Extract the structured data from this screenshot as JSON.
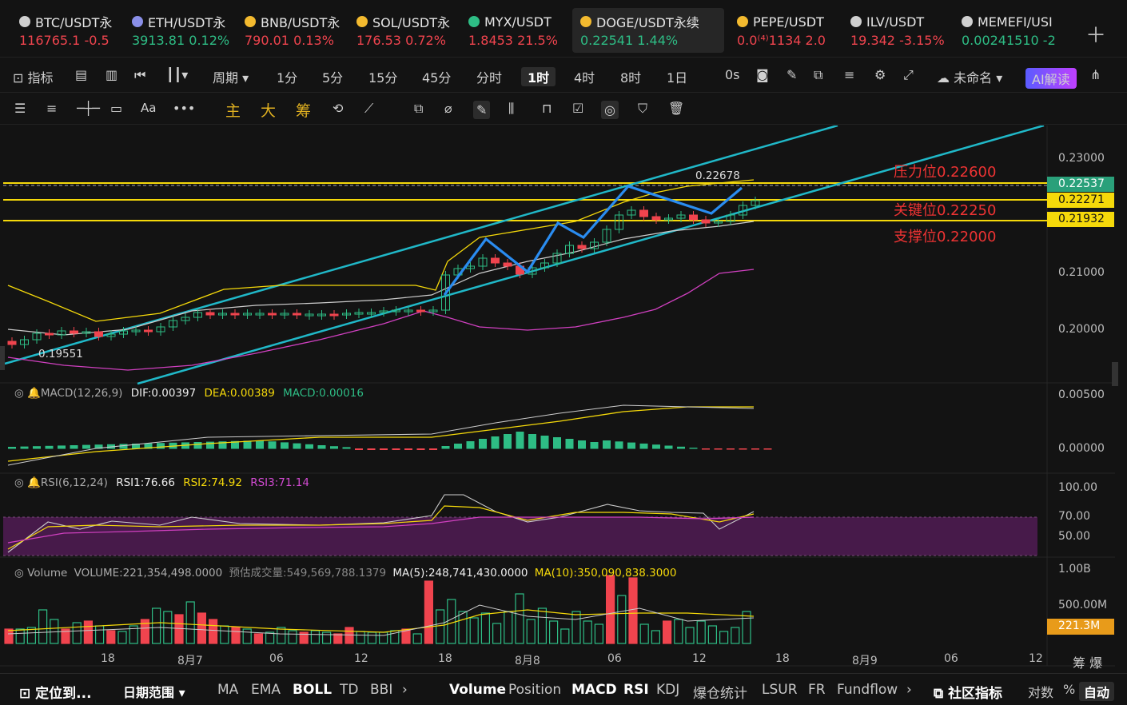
{
  "tickers": [
    {
      "symbol": "BTC/USDT永",
      "price": "116765.1",
      "change": "-0.5",
      "dir": "down",
      "color": "#d0d0d0"
    },
    {
      "symbol": "ETH/USDT永",
      "price": "3913.81",
      "change": "0.12%",
      "dir": "up",
      "color": "#8a8fe8"
    },
    {
      "symbol": "BNB/USDT永",
      "price": "790.01",
      "change": "0.13%",
      "dir": "down",
      "color": "#f3ba2f"
    },
    {
      "symbol": "SOL/USDT永",
      "price": "176.53",
      "change": "0.72%",
      "dir": "down",
      "color": "#f3ba2f"
    },
    {
      "symbol": "MYX/USDT",
      "price": "1.8453",
      "change": "21.5%",
      "dir": "down",
      "color": "#2ebd85"
    },
    {
      "symbol": "DOGE/USDT永续",
      "price": "0.22541",
      "change": "1.44%",
      "dir": "up",
      "color": "#f3ba2f"
    },
    {
      "symbol": "PEPE/USDT",
      "price": "0.0⁽⁴⁾1134",
      "change": "2.0",
      "dir": "down",
      "color": "#f3ba2f"
    },
    {
      "symbol": "ILV/USDT",
      "price": "19.342",
      "change": "-3.15%",
      "dir": "down",
      "color": "#d0d0d0"
    },
    {
      "symbol": "MEMEFI/USI",
      "price": "0.00241510",
      "change": "-2",
      "dir": "up",
      "color": "#d0d0d0"
    }
  ],
  "toolbar": {
    "indicator": "指标",
    "period": "周期",
    "intervals": [
      "1分",
      "5分",
      "15分",
      "45分",
      "分时",
      "1时",
      "4时",
      "8时",
      "1日"
    ],
    "active_interval": "1时",
    "seconds": "0s",
    "layout_name": "未命名",
    "ai": "AI解读"
  },
  "drawing_tools": {
    "main": "主",
    "big": "大",
    "chip": "筹",
    "font": "Aa"
  },
  "chart": {
    "price_axis": [
      "0.23000",
      "0.21000",
      "0.20000"
    ],
    "tags": {
      "current": "0.22537",
      "mid": "0.22271",
      "low": "0.21932"
    },
    "levels": {
      "resistance": "压力位0.22600",
      "key": "关键位0.22250",
      "support": "支撑位0.22000"
    },
    "high_marker": "0.22678",
    "low_marker": "0.19551",
    "macd": {
      "title": "MACD(12,26,9)",
      "dif": "DIF:0.00397",
      "dea": "DEA:0.00389",
      "macd": "MACD:0.00016",
      "axis": [
        "0.00500",
        "0.00000"
      ]
    },
    "rsi": {
      "title": "RSI(6,12,24)",
      "rsi1": "RSI1:76.66",
      "rsi2": "RSI2:74.92",
      "rsi3": "RSI3:71.14",
      "axis": [
        "100.00",
        "70.00",
        "50.00"
      ]
    },
    "volume": {
      "title": "Volume",
      "value": "VOLUME:221,354,498.0000",
      "est": "预估成交量:549,569,788.1379",
      "ma5": "MA(5):248,741,430.0000",
      "ma10": "MA(10):350,090,838.3000",
      "axis_top": "1.00B",
      "axis_mid": "500.00M",
      "tag": "221.3M"
    },
    "x_labels": [
      "18",
      "8月7",
      "06",
      "12",
      "18",
      "8月8",
      "06",
      "12",
      "18",
      "8月9",
      "06",
      "12"
    ],
    "x_right": "筹  爆"
  },
  "bottom": {
    "locate": "定位到...",
    "range": "日期范围",
    "main_inds": [
      "MA",
      "EMA",
      "BOLL",
      "TD",
      "BBI"
    ],
    "sub_inds": [
      "Volume",
      "Position",
      "MACD",
      "RSI",
      "KDJ",
      "爆仓统计",
      "LSUR",
      "FR",
      "Fundflow"
    ],
    "community": "社区指标",
    "log": "对数",
    "pct": "%",
    "auto": "自动"
  },
  "colors": {
    "up": "#2ebd85",
    "down": "#f0444e",
    "yellow": "#f5d90a",
    "channel": "#20b8c8",
    "zigzag": "#2a8cf0",
    "purple": "#5a1e5e"
  }
}
